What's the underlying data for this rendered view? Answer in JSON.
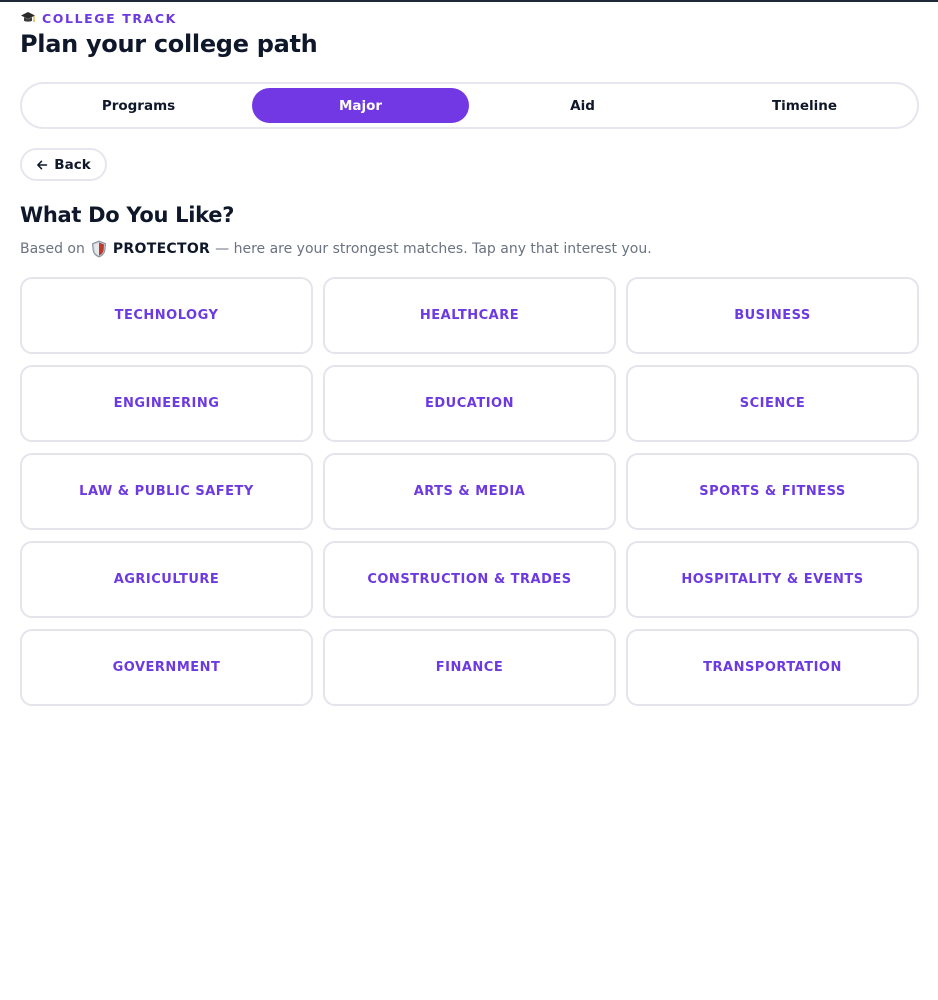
{
  "header": {
    "eyebrow_icon": "graduation-cap-icon",
    "eyebrow": "COLLEGE TRACK",
    "title": "Plan your college path"
  },
  "tabs": [
    {
      "label": "Programs",
      "active": false
    },
    {
      "label": "Major",
      "active": true
    },
    {
      "label": "Aid",
      "active": false
    },
    {
      "label": "Timeline",
      "active": false
    }
  ],
  "back": {
    "label": "Back",
    "icon": "arrow-left-icon"
  },
  "section": {
    "title": "What Do You Like?",
    "subtitle_prefix": "Based on",
    "persona_icon": "shield-icon",
    "persona": "PROTECTOR",
    "subtitle_suffix": "— here are your strongest matches. Tap any that interest you."
  },
  "interests": [
    "TECHNOLOGY",
    "HEALTHCARE",
    "BUSINESS",
    "ENGINEERING",
    "EDUCATION",
    "SCIENCE",
    "LAW & PUBLIC SAFETY",
    "ARTS & MEDIA",
    "SPORTS & FITNESS",
    "AGRICULTURE",
    "CONSTRUCTION & TRADES",
    "HOSPITALITY & EVENTS",
    "GOVERNMENT",
    "FINANCE",
    "TRANSPORTATION"
  ],
  "colors": {
    "accent": "#7238e4",
    "accent_text": "#6d3ae0",
    "border": "#e4e5ec",
    "muted_text": "#6b7280",
    "heading": "#0f172a"
  }
}
